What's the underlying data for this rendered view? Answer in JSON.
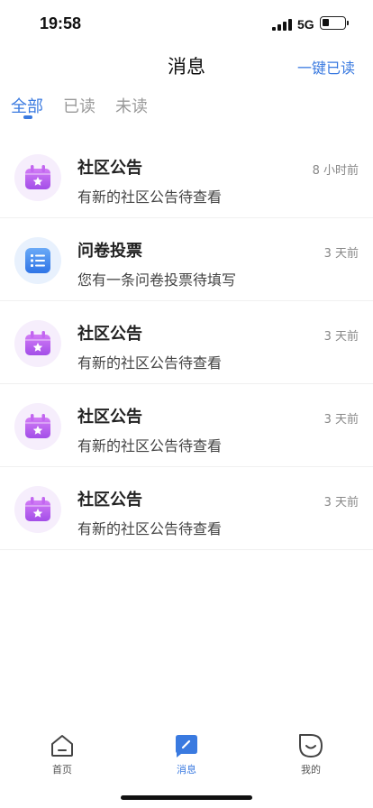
{
  "status_bar": {
    "time": "19:58",
    "network": "5G",
    "battery_level": 0.3
  },
  "header": {
    "title": "消息",
    "mark_all_read": "一键已读"
  },
  "tabs": [
    {
      "label": "全部",
      "active": true
    },
    {
      "label": "已读",
      "active": false
    },
    {
      "label": "未读",
      "active": false
    }
  ],
  "messages": [
    {
      "icon": "announcement-calendar-icon",
      "title": "社区公告",
      "desc": "有新的社区公告待查看",
      "time": "8 小时前"
    },
    {
      "icon": "survey-list-icon",
      "title": "问卷投票",
      "desc": "您有一条问卷投票待填写",
      "time": "3 天前"
    },
    {
      "icon": "announcement-calendar-icon",
      "title": "社区公告",
      "desc": "有新的社区公告待查看",
      "time": "3 天前"
    },
    {
      "icon": "announcement-calendar-icon",
      "title": "社区公告",
      "desc": "有新的社区公告待查看",
      "time": "3 天前"
    },
    {
      "icon": "announcement-calendar-icon",
      "title": "社区公告",
      "desc": "有新的社区公告待查看",
      "time": "3 天前"
    }
  ],
  "tabbar": [
    {
      "label": "首页",
      "icon": "home-icon",
      "active": false
    },
    {
      "label": "消息",
      "icon": "message-icon",
      "active": true
    },
    {
      "label": "我的",
      "icon": "profile-icon",
      "active": false
    }
  ],
  "colors": {
    "accent": "#3a7ae0",
    "announcement": "#b35df0",
    "survey": "#3f86ee"
  }
}
